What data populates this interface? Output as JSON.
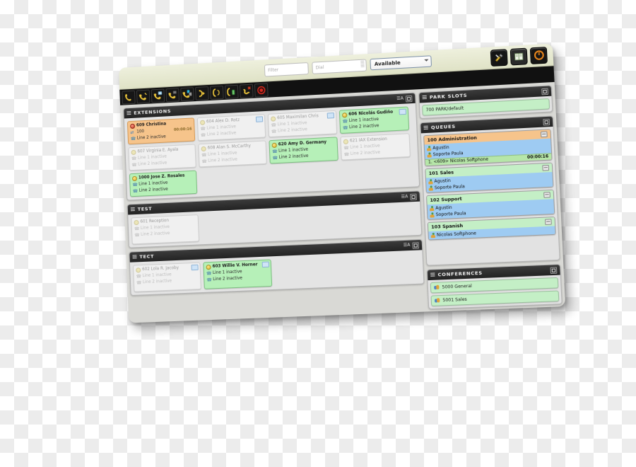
{
  "app": {
    "toolbar": {
      "filter_placeholder": "Filter",
      "dial_placeholder": "Dial",
      "status_value": "Available",
      "buttons": [
        {
          "name": "call-icon",
          "label": "Call"
        },
        {
          "name": "answer-call-icon",
          "label": "Answer"
        },
        {
          "name": "hold-call-icon",
          "label": "Hold"
        },
        {
          "name": "park-call-icon",
          "label": "Park"
        },
        {
          "name": "transfer-call-icon",
          "label": "Transfer"
        },
        {
          "name": "attended-transfer-icon",
          "label": "Attended Transfer"
        },
        {
          "name": "conference-icon",
          "label": "Conference"
        },
        {
          "name": "pickup-call-icon",
          "label": "Pickup"
        },
        {
          "name": "hangup-call-icon",
          "label": "Hangup"
        },
        {
          "name": "record-icon",
          "label": "Record"
        }
      ],
      "window_buttons": [
        {
          "name": "tools-icon",
          "label": "Tools"
        },
        {
          "name": "windows-icon",
          "label": "Windows"
        },
        {
          "name": "power-icon",
          "label": "Quit"
        }
      ]
    },
    "panels": {
      "extensions": {
        "title": "EXTENSIONS",
        "cards": [
          {
            "ext": "609",
            "name": "609 Christina",
            "state": "orange",
            "dot": "red",
            "line1": "100",
            "line1_icon": "transfer",
            "timer": "00:00:16",
            "line2": "Line 2 inactive",
            "badge": false
          },
          {
            "ext": "604",
            "name": "604 Alex D. Rotz",
            "state": "dim",
            "dot": "pale",
            "line1": "Line 1 inactive",
            "line1_icon": "phone",
            "timer": "",
            "line2": "Line 2 inactive",
            "badge": true
          },
          {
            "ext": "605",
            "name": "605 Maximilan Chris",
            "state": "dim",
            "dot": "pale",
            "line1": "Line 1 inactive",
            "line1_icon": "phone",
            "timer": "",
            "line2": "Line 2 inactive",
            "badge": true
          },
          {
            "ext": "606",
            "name": "606 Nicolás Gudiño",
            "state": "green",
            "dot": "yellow",
            "line1": "Line 1 inactive",
            "line1_icon": "phone",
            "timer": "",
            "line2": "Line 2 inactive",
            "badge": true
          },
          {
            "ext": "607",
            "name": "607 Virginia E. Ayala",
            "state": "dim",
            "dot": "pale",
            "line1": "Line 1 inactive",
            "line1_icon": "phone",
            "timer": "",
            "line2": "Line 2 inactive",
            "badge": false
          },
          {
            "ext": "608",
            "name": "608 Alan S. McCarthy",
            "state": "dim",
            "dot": "pale",
            "line1": "Line 1 inactive",
            "line1_icon": "phone",
            "timer": "",
            "line2": "Line 2 inactive",
            "badge": false
          },
          {
            "ext": "620",
            "name": "620 Amy D. Germany",
            "state": "green",
            "dot": "yellow",
            "line1": "Line 1 inactive",
            "line1_icon": "phone",
            "timer": "",
            "line2": "Line 2 inactive",
            "badge": false
          },
          {
            "ext": "621",
            "name": "621 IAX Extension",
            "state": "dim",
            "dot": "pale",
            "line1": "Line 1 inactive",
            "line1_icon": "phone",
            "timer": "",
            "line2": "Line 2 inactive",
            "badge": false
          },
          {
            "ext": "1000",
            "name": "1000 Jose Z. Rosales",
            "state": "green",
            "dot": "yellow",
            "line1": "Line 1 inactive",
            "line1_icon": "phone",
            "timer": "",
            "line2": "Line 2 inactive",
            "badge": false
          }
        ]
      },
      "test": {
        "title": "TEST",
        "cards": [
          {
            "ext": "601",
            "name": "601 Reception",
            "state": "dim",
            "dot": "pale",
            "line1": "Line 1 inactive",
            "line1_icon": "phone",
            "timer": "",
            "line2": "Line 2 inactive",
            "badge": false
          }
        ]
      },
      "tect": {
        "title": "TECT",
        "cards": [
          {
            "ext": "602",
            "name": "602 Lola R. Jacoby",
            "state": "dim",
            "dot": "pale",
            "line1": "Line 1 inactive",
            "line1_icon": "phone",
            "timer": "",
            "line2": "Line 2 inactive",
            "badge": true
          },
          {
            "ext": "603",
            "name": "603 Willie V. Horner",
            "state": "green",
            "dot": "yellow",
            "line1": "Line 1 inactive",
            "line1_icon": "phone",
            "timer": "",
            "line2": "Line 2 inactive",
            "badge": true
          }
        ]
      },
      "park_slots": {
        "title": "PARK SLOTS",
        "slots": [
          {
            "label": "700 PARK/default"
          }
        ]
      },
      "queues": {
        "title": "QUEUES",
        "items": [
          {
            "title": "100 Administration",
            "state": "admin",
            "members": [
              "Agustin",
              "Soporte Paula"
            ],
            "call": {
              "label": "1. <609> Nicolas Softphone",
              "timer": "00:00:16"
            }
          },
          {
            "title": "101 Sales",
            "state": "green",
            "members": [
              "Agustin",
              "Soporte Paula"
            ],
            "call": null
          },
          {
            "title": "102 Support",
            "state": "green",
            "members": [
              "Agustin",
              "Soporte Paula"
            ],
            "call": null
          },
          {
            "title": "103 Spanish",
            "state": "green",
            "members": [
              "Nicolas Softphone"
            ],
            "call": null
          }
        ]
      },
      "conferences": {
        "title": "CONFERENCES",
        "rooms": [
          {
            "label": "5000 General"
          },
          {
            "label": "5001 Sales"
          }
        ]
      }
    },
    "colors": {
      "active_green": "#b6f0b8",
      "ringing_orange": "#f6c48b",
      "member_blue": "#9ecbf2",
      "header_dark": "#2b2b2b",
      "power_orange": "#f08a1c"
    }
  }
}
